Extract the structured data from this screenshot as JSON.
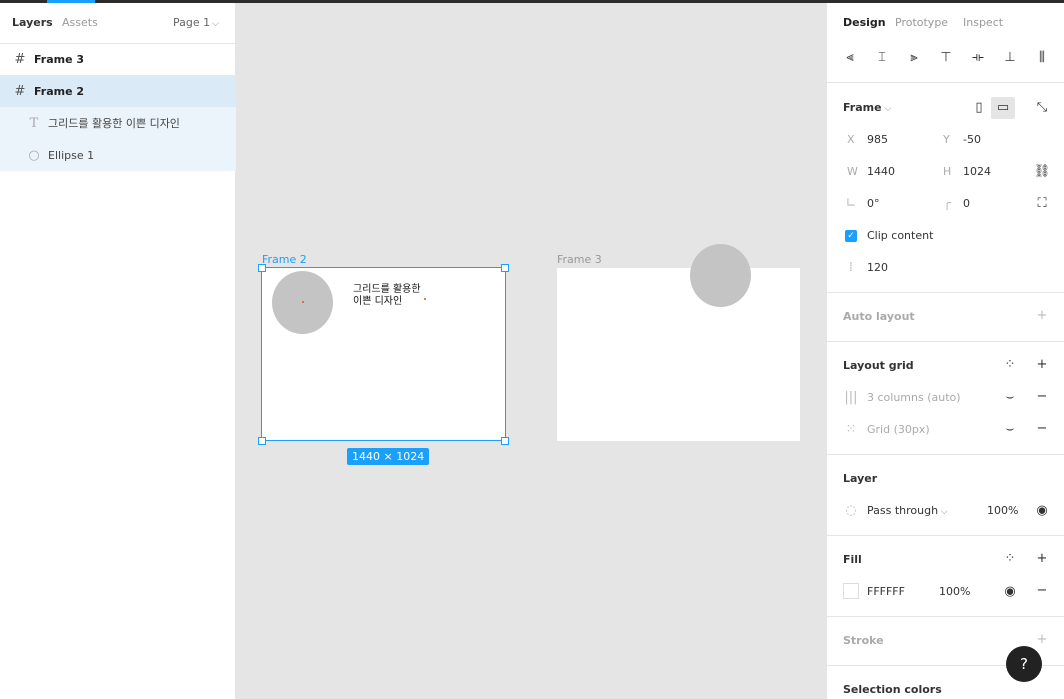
{
  "left_panel": {
    "tabs": {
      "layers": "Layers",
      "assets": "Assets"
    },
    "page_selector": "Page 1",
    "layers": [
      {
        "name": "Frame 3",
        "icon": "frame-icon"
      },
      {
        "name": "Frame 2",
        "icon": "frame-icon",
        "selected": true
      },
      {
        "name": "그리드를 활용한 이쁜 디자인",
        "icon": "text-icon"
      },
      {
        "name": "Ellipse 1",
        "icon": "ellipse-icon"
      }
    ]
  },
  "canvas": {
    "frame2": {
      "label": "Frame 2",
      "text_line1": "그리드를 활용한",
      "text_line2": "이쁜 디자인",
      "size_badge": "1440 × 1024"
    },
    "frame3": {
      "label": "Frame 3"
    }
  },
  "right_panel": {
    "tabs": {
      "design": "Design",
      "prototype": "Prototype",
      "inspect": "Inspect"
    },
    "frame": {
      "title": "Frame",
      "x_label": "X",
      "x": "985",
      "y_label": "Y",
      "y": "-50",
      "w_label": "W",
      "w": "1440",
      "h_label": "H",
      "h": "1024",
      "rotation": "0°",
      "radius": "0",
      "clip_content": "Clip content",
      "spacing": "120"
    },
    "auto_layout": "Auto layout",
    "layout_grid": {
      "title": "Layout grid",
      "items": [
        "3 columns (auto)",
        "Grid (30px)"
      ]
    },
    "layer": {
      "title": "Layer",
      "blend": "Pass through",
      "opacity": "100%"
    },
    "fill": {
      "title": "Fill",
      "hex": "FFFFFF",
      "opacity": "100%"
    },
    "stroke": "Stroke",
    "selection_colors": "Selection colors"
  },
  "help": "?",
  "colors": {
    "accent": "#18a0fb",
    "canvas": "#e5e5e5",
    "shape": "#c4c4c4"
  }
}
